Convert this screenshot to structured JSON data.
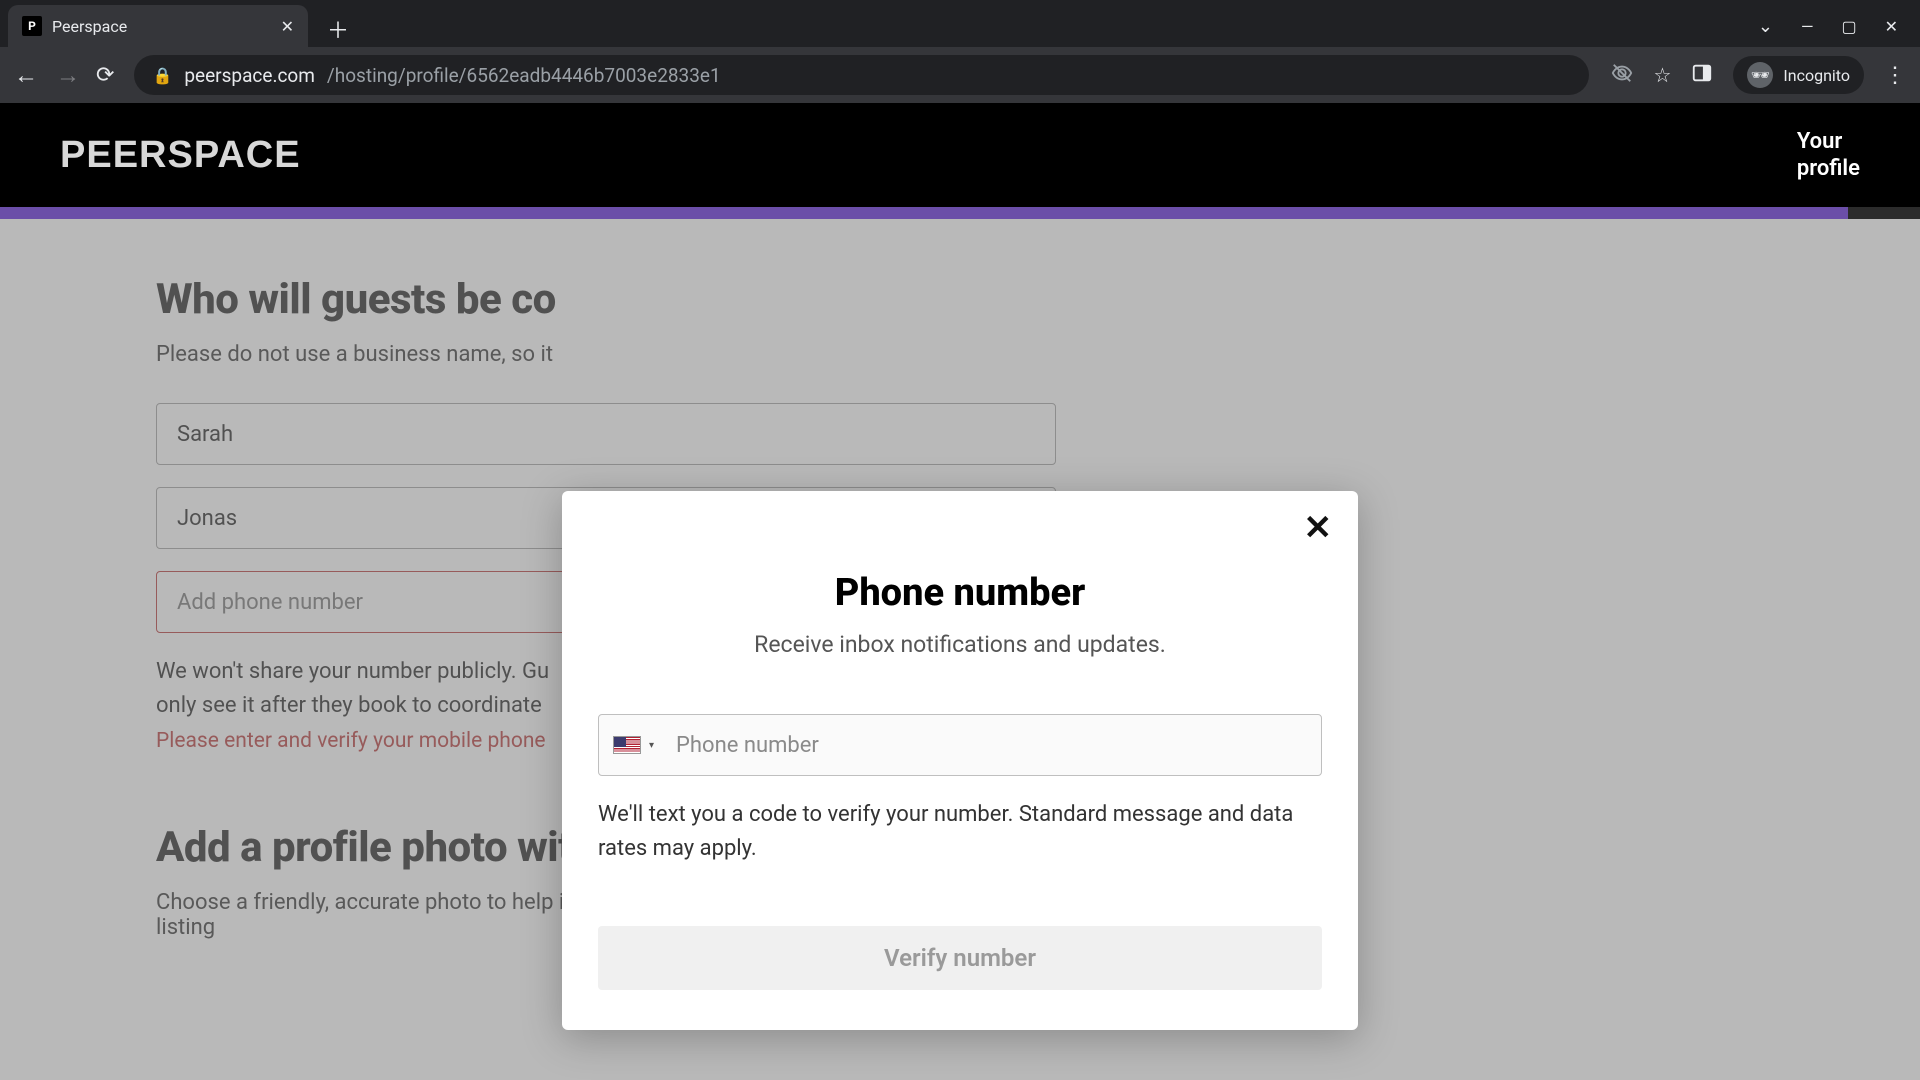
{
  "browser": {
    "tab_title": "Peerspace",
    "favicon_letter": "P",
    "url_host": "peerspace.com",
    "url_path": "/hosting/profile/6562eadb4446b7003e2833e1",
    "incognito_label": "Incognito"
  },
  "header": {
    "logo_text": "PEERSPACE",
    "profile_line1": "Your",
    "profile_line2": "profile"
  },
  "page": {
    "h1": "Who will guests be co",
    "sub": "Please do not use a business name, so it",
    "first_name_value": "Sarah",
    "last_name_value": "Jonas",
    "phone_placeholder": "Add phone number",
    "note_line1": "We won't share your number publicly. Gu",
    "note_line2": "only see it after they book to coordinate",
    "error_text": "Please enter and verify your mobile phone",
    "h2": "Add a profile photo with your face",
    "sub2": "Choose a friendly, accurate photo to help instill a sense of trust and verification in your listing"
  },
  "modal": {
    "title": "Phone number",
    "subtitle": "Receive inbox notifications and updates.",
    "phone_placeholder": "Phone number",
    "help_text": "We'll text you a code to verify your number. Standard message and data rates may apply.",
    "verify_label": "Verify number",
    "country_selected": "US"
  }
}
